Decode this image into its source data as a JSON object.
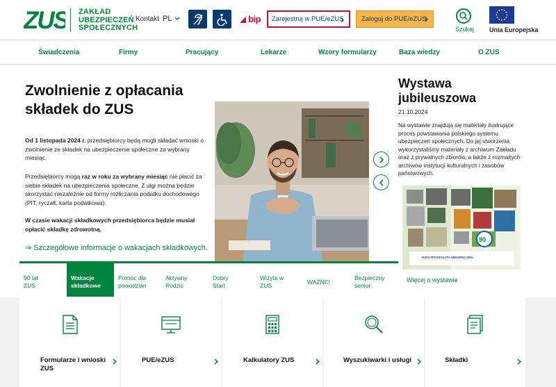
{
  "header": {
    "logo_text": "ZUS",
    "org_name_line1": "ZAKŁAD",
    "org_name_line2": "UBEZPIECZEŃ",
    "org_name_line3": "SPOŁECZNYCH",
    "contact_label": "Kontakt",
    "language": "PL",
    "bip_label": "bip",
    "register_button": "Zarejestruj w PUE/eZUS",
    "login_button": "Zaloguj do PUE/eZUS",
    "search_label": "Szukaj",
    "eu_label": "Unia Europejska"
  },
  "nav": [
    "Świadczenia",
    "Firmy",
    "Pracujący",
    "Lekarze",
    "Wzory formularzy",
    "Baza wiedzy",
    "O ZUS"
  ],
  "hero": {
    "title": "Zwolnienie z opłacania składek do ZUS",
    "p1_bold": "Od 1 listopada 2024 r.",
    "p1_rest": " przedsiębiorcy będą mogli składać wnioski o zwolnienie ze składek na ubezpieczenie społeczne za wybrany miesiąc.",
    "p2_a": "Przedsiębiorcy mogą ",
    "p2_bold": "raz w roku za wybrany miesiąc",
    "p2_rest": " nie płacić za siebie składek na ubezpieczenia społeczne. Z ulgi można będzie skorzystać niezależnie od formy rozliczania podatku dochodowego (PIT, ryczałt, karta podatkowa).",
    "p3_bold": "W czasie wakacji składkowych przedsiębiorca będzie musiał opłacić składkę zdrowotną.",
    "link": "⇒ Szczegółowe informacje o wakacjach składkowych."
  },
  "side": {
    "title": "Wystawa jubileuszowa",
    "date": "21.10.2024",
    "text": "Na wystawie znajdują się materiały ilustrujące proces powstawania polskiego systemu ubezpieczeń społecznych. Do jej stworzenia wykorzystaliśmy materiały z archiwum Zakładu oraz z prywatnych zbiorów, a także z rozmaitych archiwów instytucji kulturalnych i zasobów państwowych.",
    "poster_caption": "RZECZPOSPOLITA UBEZPIECZEŃ",
    "more": "Więcej o wystawie"
  },
  "tabs": [
    {
      "label": "90 lat ZUS"
    },
    {
      "label": "Wakacje składkowe"
    },
    {
      "label": "Pomoc dla powodzian"
    },
    {
      "label": "Aktywny Rodzic"
    },
    {
      "label": "Dobry Start"
    },
    {
      "label": "Wizyta w ZUS"
    },
    {
      "label": "WAŻNE!"
    },
    {
      "label": "Bezpieczny senior"
    }
  ],
  "tiles": [
    {
      "label": "Formularze i wnioski ZUS"
    },
    {
      "label": "PUE/eZUS"
    },
    {
      "label": "Kalkulatory ZUS"
    },
    {
      "label": "Wyszukiwarki i usługi"
    },
    {
      "label": "Składki"
    }
  ],
  "colors": {
    "green": "#00843d",
    "navy": "#083a72",
    "red": "#c8102e",
    "orange": "#f6b547"
  }
}
